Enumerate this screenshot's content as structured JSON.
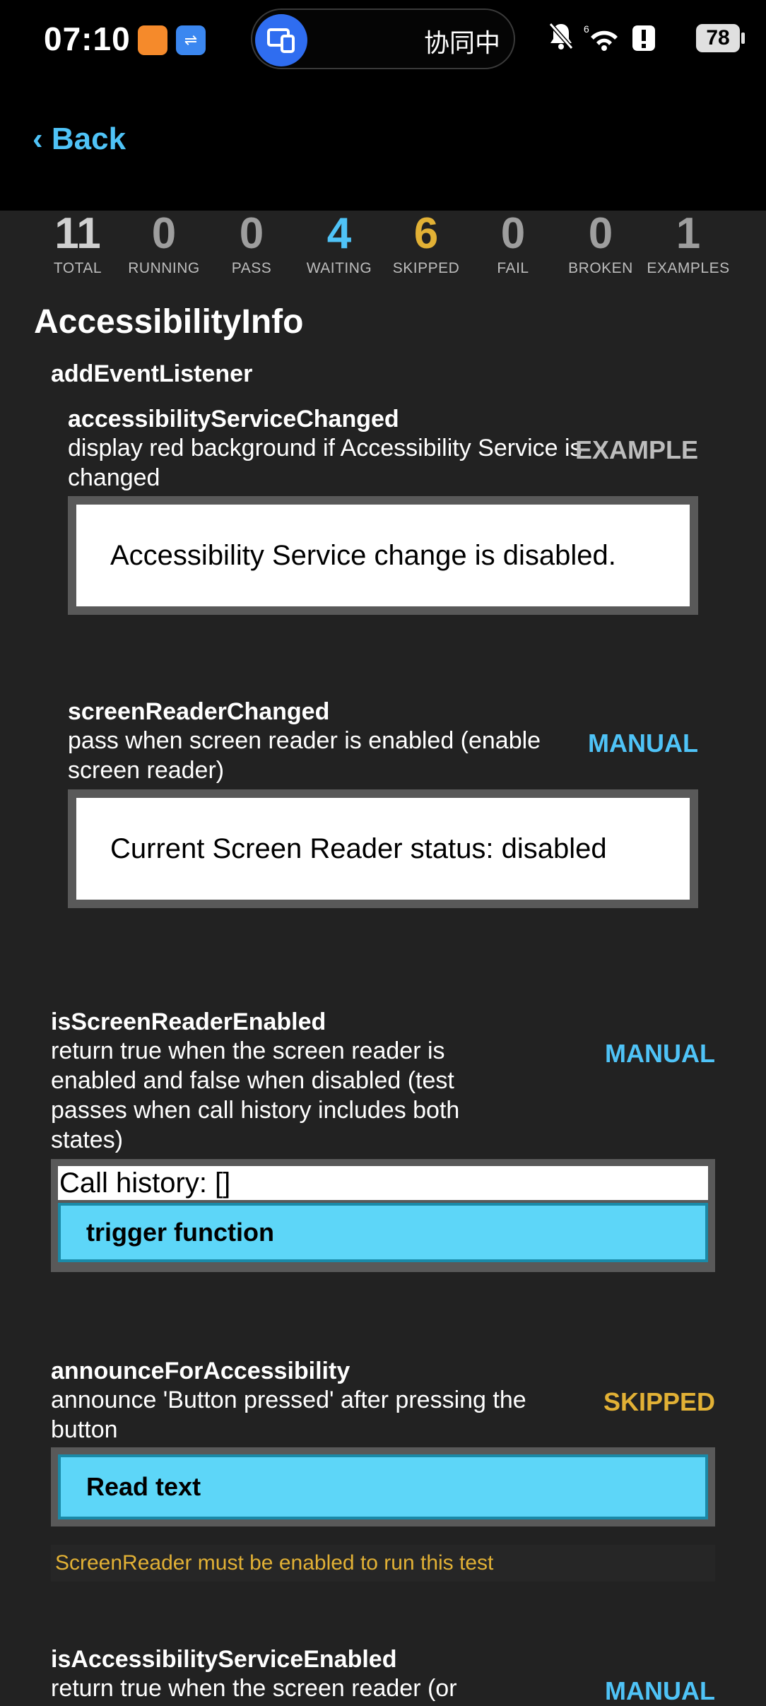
{
  "statusbar": {
    "time": "07:10",
    "pill_text": "协同中",
    "battery": "78",
    "icons": [
      "notification-off-icon",
      "wifi-icon",
      "alert-icon",
      "battery-icon"
    ]
  },
  "header": {
    "back_label": "‹ Back"
  },
  "summary": [
    {
      "value": "11",
      "label": "TOTAL",
      "color": "#d0d0d0"
    },
    {
      "value": "0",
      "label": "RUNNING",
      "color": "#9e9e9e"
    },
    {
      "value": "0",
      "label": "PASS",
      "color": "#9e9e9e"
    },
    {
      "value": "4",
      "label": "WAITING",
      "color": "#4fc3f7"
    },
    {
      "value": "6",
      "label": "SKIPPED",
      "color": "#e2b135"
    },
    {
      "value": "0",
      "label": "FAIL",
      "color": "#9e9e9e"
    },
    {
      "value": "0",
      "label": "BROKEN",
      "color": "#9e9e9e"
    },
    {
      "value": "1",
      "label": "EXAMPLES",
      "color": "#9e9e9e"
    }
  ],
  "module_title": "AccessibilityInfo",
  "group_title": "addEventListener",
  "tests": {
    "t1": {
      "name": "accessibilityServiceChanged",
      "desc": "display red background if Accessibility Service is changed",
      "status": "EXAMPLE",
      "status_color": "#bdbdbd",
      "box_text": "Accessibility Service change is disabled."
    },
    "t2": {
      "name": "screenReaderChanged",
      "desc": "pass when screen reader is enabled (enable screen reader)",
      "status": "MANUAL",
      "status_color": "#4fc3f7",
      "box_text": "Current Screen Reader status: disabled"
    },
    "t3": {
      "name": "isScreenReaderEnabled",
      "desc": "return true when the screen reader is enabled and false when disabled (test passes when call history includes both states)",
      "status": "MANUAL",
      "status_color": "#4fc3f7",
      "call_history": "Call history: []",
      "button": "trigger function"
    },
    "t4": {
      "name": "announceForAccessibility",
      "desc": "announce 'Button pressed' after pressing the button",
      "status": "SKIPPED",
      "status_color": "#e2b135",
      "button": "Read text",
      "note": "ScreenReader must be enabled to run this test"
    },
    "t5": {
      "name": "isAccessibilityServiceEnabled",
      "desc": "return true when the screen reader (or",
      "status": "MANUAL",
      "status_color": "#4fc3f7"
    }
  }
}
